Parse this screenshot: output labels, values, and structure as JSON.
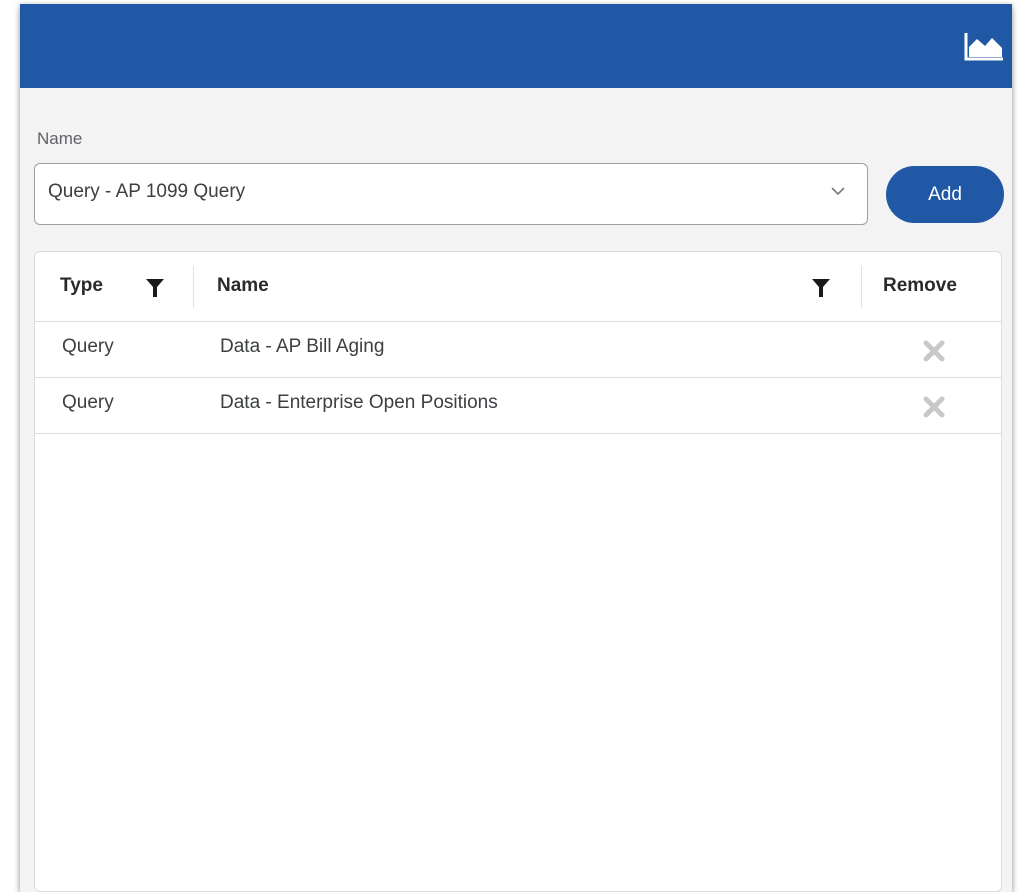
{
  "header": {
    "icon": "area-chart-icon",
    "color": "#2158a5"
  },
  "form": {
    "name_label": "Name",
    "selected_value": "Query - AP 1099 Query",
    "add_label": "Add"
  },
  "grid": {
    "columns": {
      "type": "Type",
      "name": "Name",
      "remove": "Remove"
    },
    "rows": [
      {
        "type": "Query",
        "name": "Data - AP Bill Aging"
      },
      {
        "type": "Query",
        "name": "Data - Enterprise Open Positions"
      }
    ]
  }
}
